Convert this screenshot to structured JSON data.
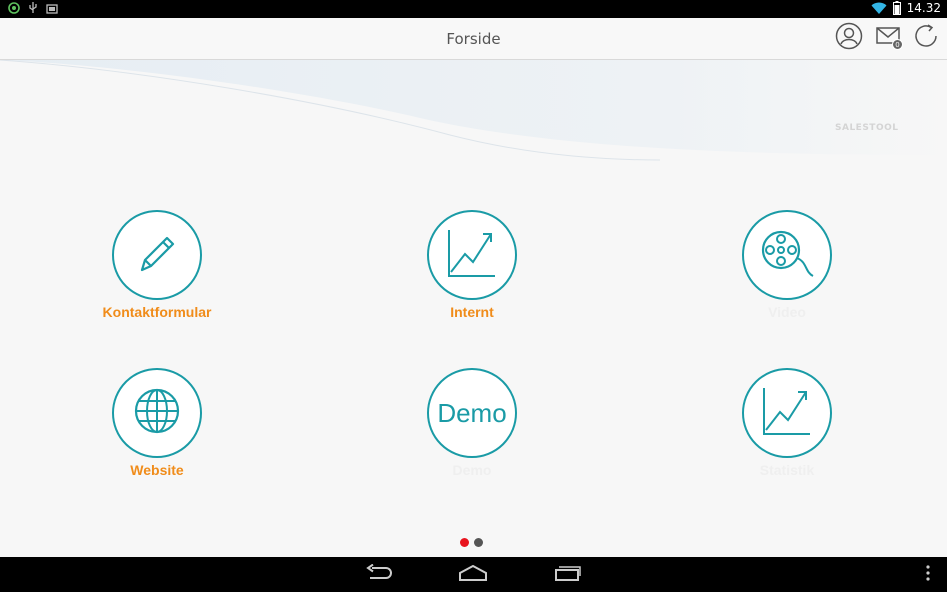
{
  "status_bar": {
    "time": "14.32",
    "icons": [
      "app-notification-icon",
      "usb-icon",
      "screenshot-icon",
      "wifi-icon",
      "battery-icon"
    ]
  },
  "action_bar": {
    "title": "Forside",
    "mail_count": "0",
    "icons": [
      "profile-icon",
      "mail-icon",
      "refresh-icon"
    ]
  },
  "content": {
    "brand": "SALESTOOL",
    "tiles": [
      {
        "label": "Kontaktformular",
        "icon": "pencil-icon"
      },
      {
        "label": "Internt",
        "icon": "chart-icon"
      },
      {
        "label": "Video",
        "icon": "film-reel-icon"
      },
      {
        "label": "Website",
        "icon": "globe-icon"
      },
      {
        "label": "Demo",
        "icon_text": "Demo"
      },
      {
        "label": "Statistik",
        "icon": "chart-icon"
      }
    ],
    "page_indicator": {
      "count": 2,
      "active_index": 0
    }
  },
  "colors": {
    "accent": "#1a9ba6",
    "label": "#f08c1a",
    "active_dot": "#e8141e"
  }
}
